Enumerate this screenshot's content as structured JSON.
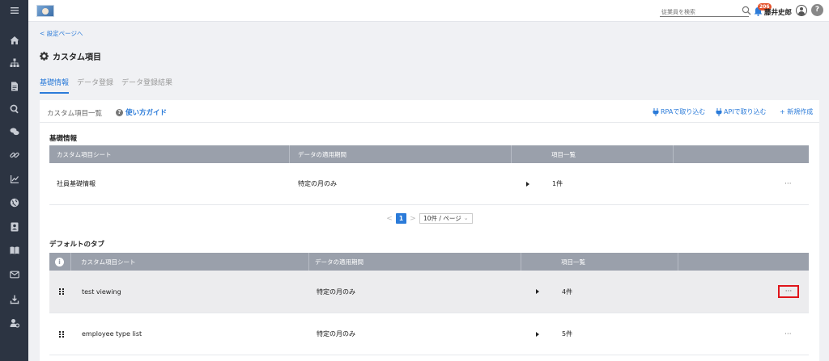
{
  "sidebar": {
    "items": [
      {
        "icon": "menu-icon"
      },
      {
        "icon": "home-icon"
      },
      {
        "icon": "org-chart-icon"
      },
      {
        "icon": "document-icon"
      },
      {
        "icon": "search-icon"
      },
      {
        "icon": "chat-icon"
      },
      {
        "icon": "link-icon"
      },
      {
        "icon": "chart-icon"
      },
      {
        "icon": "globe-icon"
      },
      {
        "icon": "contact-card-icon"
      },
      {
        "icon": "book-icon"
      },
      {
        "icon": "mail-icon"
      },
      {
        "icon": "download-icon"
      },
      {
        "icon": "user-settings-icon"
      }
    ]
  },
  "topbar": {
    "search_placeholder": "従業員を検索",
    "notification_count": "206",
    "user_name": "藤井史郎",
    "help_label": "?"
  },
  "header": {
    "back_link": "< 設定ページへ",
    "title": "カスタム項目",
    "tabs": [
      {
        "label": "基礎情報",
        "active": true
      },
      {
        "label": "データ登録",
        "active": false
      },
      {
        "label": "データ登録結果",
        "active": false
      }
    ]
  },
  "card": {
    "title": "カスタム項目一覧",
    "guide": "使い方ガイド",
    "actions": {
      "rpa": "RPAで取り込む",
      "api": "APIで取り込む",
      "new": "+ 新規作成"
    }
  },
  "basic_section": {
    "title": "基礎情報",
    "columns": [
      "カスタム項目シート",
      "データの適用期間",
      "項目一覧"
    ],
    "rows": [
      {
        "sheet": "社員基礎情報",
        "period": "特定の月のみ",
        "count": "1件",
        "more": "···"
      }
    ]
  },
  "pagination": {
    "prev": "<",
    "page": "1",
    "next": ">",
    "page_size": "10件 / ページ"
  },
  "default_section": {
    "title": "デフォルトのタブ",
    "info": "i",
    "columns": [
      "カスタム項目シート",
      "データの適用期間",
      "項目一覧"
    ],
    "rows": [
      {
        "sheet": "test viewing",
        "period": "特定の月のみ",
        "count": "4件",
        "more": "···",
        "highlighted": true
      },
      {
        "sheet": "employee type list",
        "period": "特定の月のみ",
        "count": "5件",
        "more": "···",
        "highlighted": false
      }
    ]
  },
  "colors": {
    "accent": "#2b7bd9",
    "sidebar": "#2c3442",
    "table_header": "#9aa0ab",
    "highlight_border": "#e0151b",
    "badge": "#e5532d"
  }
}
